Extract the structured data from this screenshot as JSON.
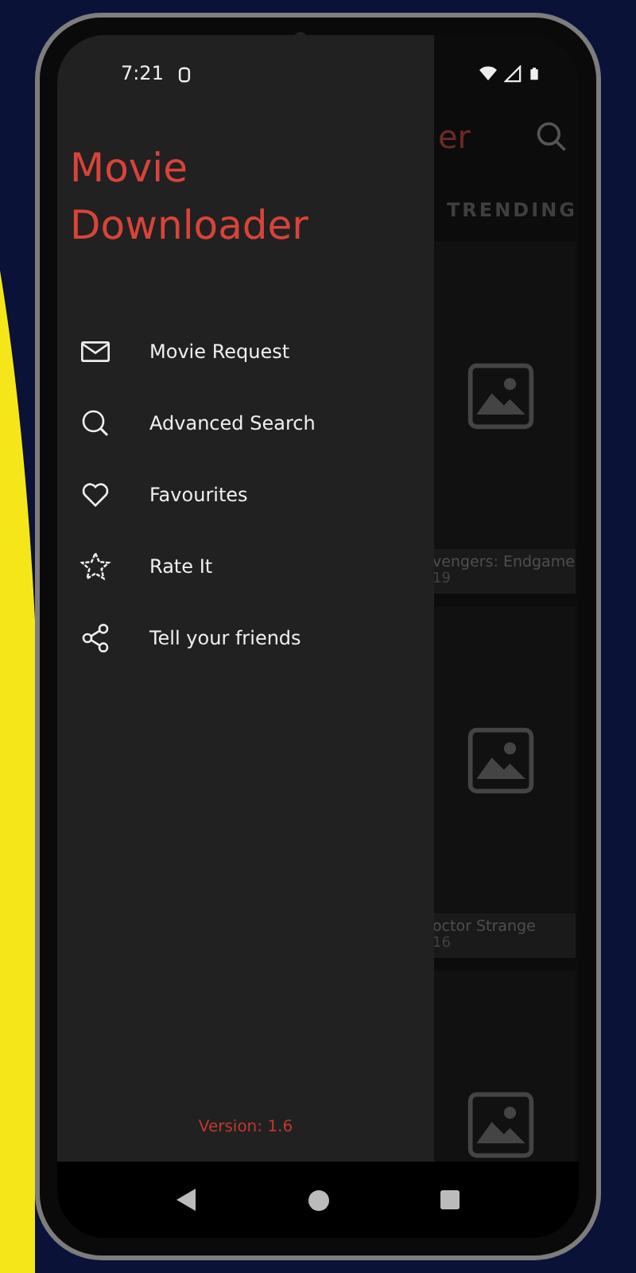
{
  "status_bar": {
    "time": "7:21"
  },
  "app": {
    "title_fragment": "er",
    "tab": "TRENDING",
    "movies": [
      {
        "kind": "captioned",
        "title": "vengers: Endgame",
        "year": "19"
      },
      {
        "kind": "captioned",
        "title": "octor Strange",
        "year": "16"
      },
      {
        "kind": "poster_only"
      }
    ]
  },
  "drawer": {
    "title": "Movie Downloader",
    "items": [
      {
        "kind": "request",
        "label": "Movie Request"
      },
      {
        "kind": "search",
        "label": "Advanced Search"
      },
      {
        "kind": "favourite",
        "label": "Favourites"
      },
      {
        "kind": "rate",
        "label": "Rate It"
      },
      {
        "kind": "share",
        "label": "Tell your friends"
      }
    ],
    "version": "Version: 1.6"
  }
}
